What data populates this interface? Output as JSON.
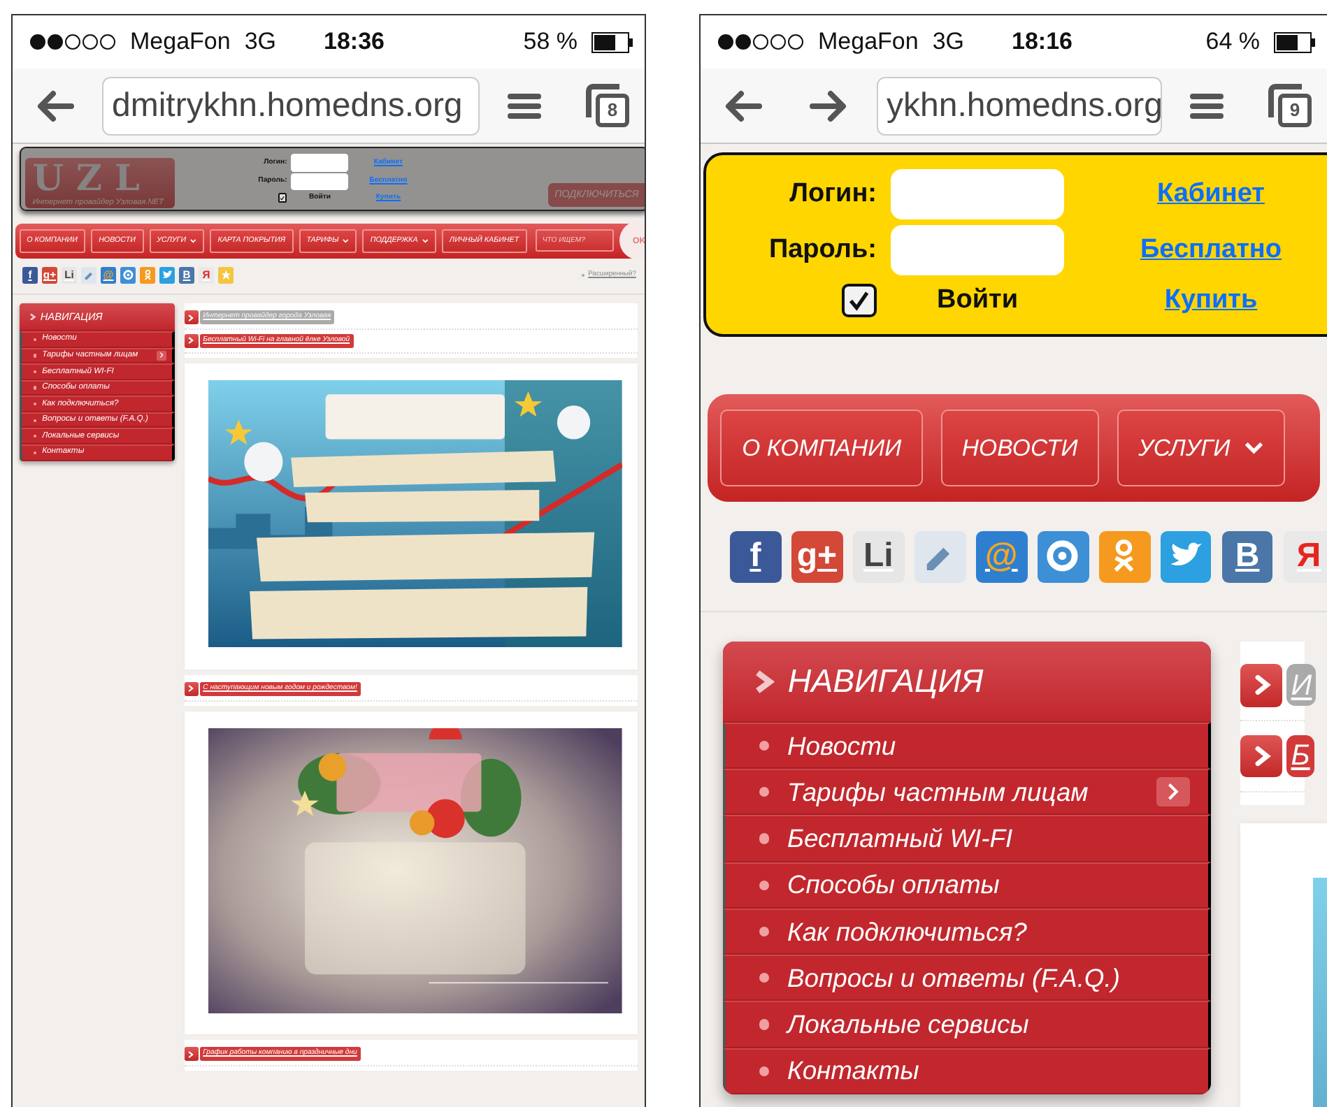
{
  "phones": [
    {
      "status": {
        "carrier": "MegaFon",
        "network": "3G",
        "time": "18:36",
        "battery": "58 %"
      },
      "toolbar": {
        "forward_button": false,
        "url": "dmitrykhn.homedns.org",
        "tab_count": "8"
      },
      "logo": {
        "text": "UZL",
        "tagline": "Интернет провайдер Узловая.NET"
      },
      "connect_button": "ПОДКЛЮЧИТЬСЯ",
      "login": {
        "highlighted": false,
        "login_label": "Логин:",
        "password_label": "Пароль:",
        "remember": true,
        "submit": "Войти",
        "links": [
          "Кабинет",
          "Бесплатно",
          "Купить"
        ]
      },
      "menu": [
        {
          "label": "О КОМПАНИИ",
          "dropdown": false
        },
        {
          "label": "НОВОСТИ",
          "dropdown": false
        },
        {
          "label": "УСЛУГИ",
          "dropdown": true
        },
        {
          "label": "КАРТА ПОКРЫТИЯ",
          "dropdown": false
        },
        {
          "label": "ТАРИФЫ",
          "dropdown": true
        },
        {
          "label": "ПОДДЕРЖКА",
          "dropdown": true
        },
        {
          "label": "ЛИЧНЫЙ КАБИНЕТ",
          "dropdown": false
        }
      ],
      "search": {
        "placeholder": "ЧТО ИЩЕМ?",
        "button": "OK"
      },
      "socials": [
        {
          "label": "f",
          "color": "#3b5998"
        },
        {
          "label": "g+",
          "color": "#d34836"
        },
        {
          "label": "Li",
          "color": "#e6e6e6"
        },
        {
          "color": "#dfe6ee"
        },
        {
          "label": "@",
          "color": "#2f7fd0"
        },
        {
          "color": "#3d8fd6"
        },
        {
          "color": "#f59a1e"
        },
        {
          "color": "#2ca0e0"
        },
        {
          "label": "В",
          "color": "#4a76a8"
        },
        {
          "label": "Я",
          "color": "#e9e9e9"
        },
        {
          "color": "#f5c542"
        }
      ],
      "advanced_search": "Расширенный?",
      "sidebar": {
        "title": "НАВИГАЦИЯ",
        "items": [
          {
            "label": "Новости",
            "submenu": false
          },
          {
            "label": "Тарифы частным лицам",
            "submenu": true
          },
          {
            "label": "Бесплатный WI-FI",
            "submenu": false
          },
          {
            "label": "Способы оплаты",
            "submenu": false
          },
          {
            "label": "Как подключиться?",
            "submenu": false
          },
          {
            "label": "Вопросы и ответы (F.A.Q.)",
            "submenu": false
          },
          {
            "label": "Локальные сервисы",
            "submenu": false
          },
          {
            "label": "Контакты",
            "submenu": false
          }
        ]
      },
      "content": [
        {
          "kind": "faded_heading",
          "text": "Интернет провайдер города Узловая"
        },
        {
          "kind": "heading",
          "text": "Бесплатный Wi-Fi на главной ёлке Узловой"
        },
        {
          "kind": "picture"
        },
        {
          "kind": "heading",
          "text": "С наступающим новым годом и рождеством!"
        },
        {
          "kind": "picture"
        },
        {
          "kind": "heading",
          "text": "График работы компанию в праздничные дни"
        }
      ]
    },
    {
      "status": {
        "carrier": "MegaFon",
        "network": "3G",
        "time": "18:16",
        "battery": "64 %"
      },
      "toolbar": {
        "forward_button": true,
        "url": "ykhn.homedns.org",
        "tab_count": "9"
      },
      "login": {
        "highlighted": true,
        "login_label": "Логин:",
        "password_label": "Пароль:",
        "remember": true,
        "submit": "Войти",
        "links": [
          "Кабинет",
          "Бесплатно",
          "Купить"
        ]
      },
      "menu": [
        {
          "label": "О КОМПАНИИ",
          "dropdown": false
        },
        {
          "label": "НОВОСТИ",
          "dropdown": false
        },
        {
          "label": "УСЛУГИ",
          "dropdown": true
        }
      ],
      "socials": [
        {
          "label": "f",
          "color": "#3b5998"
        },
        {
          "label": "g+",
          "color": "#d34836"
        },
        {
          "label": "Li",
          "color": "#e6e6e6"
        },
        {
          "color": "#dfe6ee"
        },
        {
          "label": "@",
          "color": "#2f7fd0"
        },
        {
          "color": "#3d8fd6"
        },
        {
          "color": "#f59a1e"
        },
        {
          "color": "#2ca0e0"
        },
        {
          "label": "В",
          "color": "#4a76a8"
        },
        {
          "label": "Я",
          "color": "#e9e9e9"
        }
      ],
      "sidebar": {
        "title": "НАВИГАЦИЯ",
        "items": [
          {
            "label": "Новости",
            "submenu": false
          },
          {
            "label": "Тарифы частным лицам",
            "submenu": true
          },
          {
            "label": "Бесплатный WI-FI",
            "submenu": false
          },
          {
            "label": "Способы оплаты",
            "submenu": false
          },
          {
            "label": "Как подключиться?",
            "submenu": false
          },
          {
            "label": "Вопросы и ответы (F.A.Q.)",
            "submenu": false
          },
          {
            "label": "Локальные сервисы",
            "submenu": false
          },
          {
            "label": "Контакты",
            "submenu": false
          }
        ]
      },
      "content": [
        {
          "kind": "faded_heading",
          "text": "И"
        },
        {
          "kind": "heading",
          "text": "Б"
        },
        {
          "kind": "picture"
        }
      ]
    }
  ]
}
